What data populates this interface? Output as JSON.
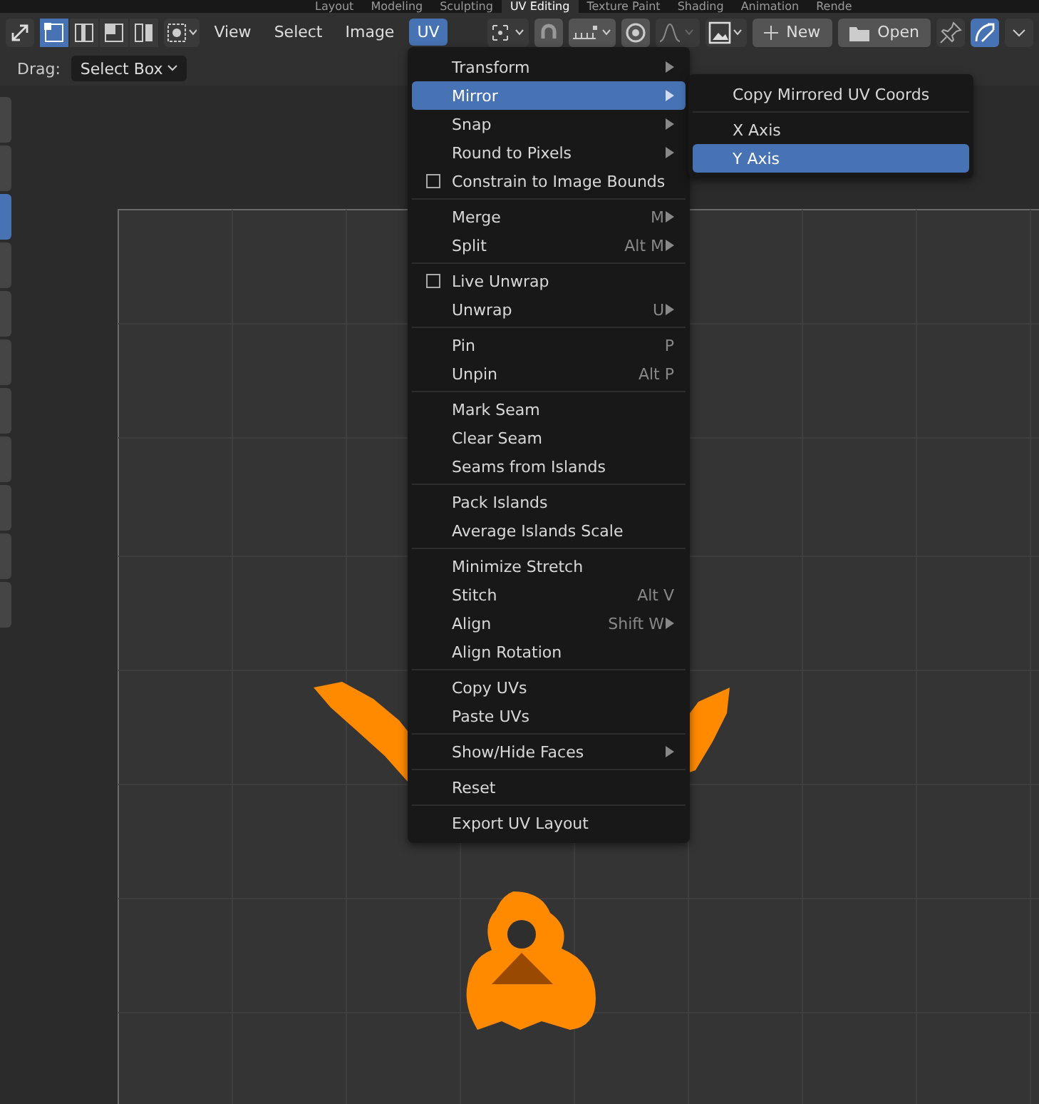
{
  "workspace_tabs": [
    {
      "label": "Layout",
      "selected": false
    },
    {
      "label": "Modeling",
      "selected": false
    },
    {
      "label": "Sculpting",
      "selected": false
    },
    {
      "label": "UV Editing",
      "selected": true
    },
    {
      "label": "Texture Paint",
      "selected": false
    },
    {
      "label": "Shading",
      "selected": false
    },
    {
      "label": "Animation",
      "selected": false
    },
    {
      "label": "Rende",
      "selected": false
    }
  ],
  "header": {
    "menus": [
      {
        "label": "View",
        "selected": false
      },
      {
        "label": "Select",
        "selected": false
      },
      {
        "label": "Image",
        "selected": false
      },
      {
        "label": "UV",
        "selected": true
      }
    ],
    "new_button": "New",
    "open_button": "Open"
  },
  "tool_settings": {
    "drag_label": "Drag:",
    "drag_value": "Select Box"
  },
  "uv_menu": {
    "sections": [
      [
        {
          "label": "Transform",
          "submenu": true,
          "kind": "plain",
          "selected": false
        },
        {
          "label": "Mirror",
          "submenu": true,
          "kind": "plain",
          "selected": true
        },
        {
          "label": "Snap",
          "submenu": true,
          "kind": "plain",
          "selected": false
        },
        {
          "label": "Round to Pixels",
          "submenu": true,
          "kind": "plain",
          "selected": false
        },
        {
          "label": "Constrain to Image Bounds",
          "submenu": false,
          "kind": "checkbox",
          "checked": false,
          "selected": false
        }
      ],
      [
        {
          "label": "Merge",
          "shortcut": "M",
          "submenu": true,
          "kind": "plain",
          "selected": false
        },
        {
          "label": "Split",
          "shortcut": "Alt M",
          "submenu": true,
          "kind": "plain",
          "selected": false
        }
      ],
      [
        {
          "label": "Live Unwrap",
          "submenu": false,
          "kind": "checkbox",
          "checked": false,
          "selected": false
        },
        {
          "label": "Unwrap",
          "shortcut": "U",
          "submenu": true,
          "kind": "plain",
          "selected": false
        }
      ],
      [
        {
          "label": "Pin",
          "shortcut": "P",
          "submenu": false,
          "kind": "plain",
          "selected": false
        },
        {
          "label": "Unpin",
          "shortcut": "Alt P",
          "submenu": false,
          "kind": "plain",
          "selected": false
        }
      ],
      [
        {
          "label": "Mark Seam",
          "submenu": false,
          "kind": "plain",
          "selected": false
        },
        {
          "label": "Clear Seam",
          "submenu": false,
          "kind": "plain",
          "selected": false
        },
        {
          "label": "Seams from Islands",
          "submenu": false,
          "kind": "plain",
          "selected": false
        }
      ],
      [
        {
          "label": "Pack Islands",
          "submenu": false,
          "kind": "plain",
          "selected": false
        },
        {
          "label": "Average Islands Scale",
          "submenu": false,
          "kind": "plain",
          "selected": false
        }
      ],
      [
        {
          "label": "Minimize Stretch",
          "submenu": false,
          "kind": "plain",
          "selected": false
        },
        {
          "label": "Stitch",
          "shortcut": "Alt V",
          "submenu": false,
          "kind": "plain",
          "selected": false
        },
        {
          "label": "Align",
          "shortcut": "Shift W",
          "submenu": true,
          "kind": "plain",
          "selected": false
        },
        {
          "label": "Align Rotation",
          "submenu": false,
          "kind": "plain",
          "selected": false
        }
      ],
      [
        {
          "label": "Copy UVs",
          "submenu": false,
          "kind": "plain",
          "selected": false
        },
        {
          "label": "Paste UVs",
          "submenu": false,
          "kind": "plain",
          "selected": false
        }
      ],
      [
        {
          "label": "Show/Hide Faces",
          "submenu": true,
          "kind": "plain",
          "selected": false
        }
      ],
      [
        {
          "label": "Reset",
          "submenu": false,
          "kind": "plain",
          "selected": false
        }
      ],
      [
        {
          "label": "Export UV Layout",
          "submenu": false,
          "kind": "plain",
          "selected": false
        }
      ]
    ]
  },
  "mirror_submenu": {
    "sections": [
      [
        {
          "label": "Copy Mirrored UV Coords",
          "selected": false
        }
      ],
      [
        {
          "label": "X Axis",
          "selected": false
        },
        {
          "label": "Y Axis",
          "selected": true
        }
      ]
    ]
  }
}
